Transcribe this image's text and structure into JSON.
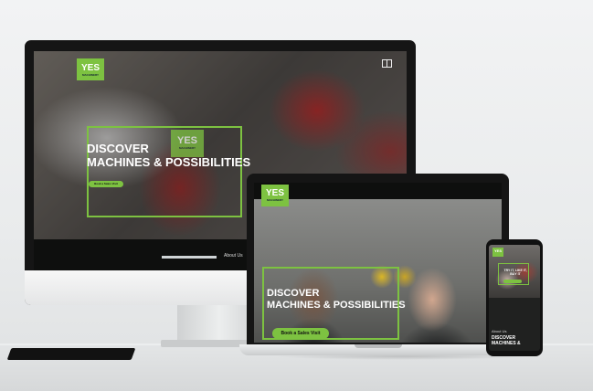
{
  "brand": {
    "logo_text": "YES",
    "logo_subtext": "MACHINERY",
    "accent_color": "#7dc241"
  },
  "desktop_site": {
    "headline_line1": "DISCOVER",
    "headline_line2": "MACHINES & POSSIBILITIES",
    "cta_label": "Book a Sales Visit",
    "nav_item": "About Us",
    "menu_icon": "menu-icon"
  },
  "laptop_site": {
    "headline_line1": "DISCOVER",
    "headline_line2": "MACHINES & POSSIBILITIES",
    "cta_label": "Book a Sales Visit"
  },
  "mobile_site": {
    "banner_text": "TRY IT, LIKE IT, BUY IT",
    "nav_item": "About Us",
    "headline_line1": "DISCOVER",
    "headline_line2": "MACHINES &"
  }
}
